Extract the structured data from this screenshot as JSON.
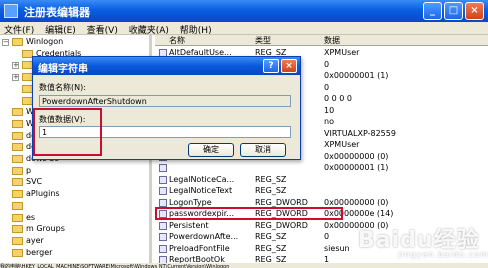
{
  "window": {
    "title": "注册表编辑器",
    "buttons": [
      "_",
      "□",
      "×"
    ]
  },
  "menu": [
    "文件(F)",
    "编辑(E)",
    "查看(V)",
    "收藏夹(A)",
    "帮助(H)"
  ],
  "tree": [
    {
      "label": "Winlogon",
      "indent": 0,
      "expander": "−"
    },
    {
      "label": "Credentials",
      "indent": 1,
      "expander": ""
    },
    {
      "label": "",
      "indent": 1,
      "expander": "+"
    },
    {
      "label": "",
      "indent": 1,
      "expander": "+"
    },
    {
      "label": "",
      "indent": 1,
      "expander": ""
    },
    {
      "label": "",
      "indent": 1,
      "expander": ""
    },
    {
      "label": "WOW",
      "indent": 0,
      "expander": ""
    },
    {
      "label": "WPAE",
      "indent": 0,
      "expander": ""
    },
    {
      "label": "dows Sc",
      "indent": 0,
      "expander": ""
    },
    {
      "label": "dows Sc",
      "indent": 0,
      "expander": ""
    },
    {
      "label": "dows Sc",
      "indent": 0,
      "expander": ""
    },
    {
      "label": "p",
      "indent": 0,
      "expander": ""
    },
    {
      "label": "SVC",
      "indent": 0,
      "expander": ""
    },
    {
      "label": "aPlugins",
      "indent": 0,
      "expander": ""
    },
    {
      "label": "",
      "indent": 0,
      "expander": ""
    },
    {
      "label": "es",
      "indent": 0,
      "expander": ""
    },
    {
      "label": "m Groups",
      "indent": 0,
      "expander": ""
    },
    {
      "label": "ayer",
      "indent": 0,
      "expander": ""
    },
    {
      "label": "berger",
      "indent": 0,
      "expander": ""
    }
  ],
  "list": {
    "headers": {
      "name": "名称",
      "type": "类型",
      "data": "数据"
    },
    "rows": [
      {
        "name": "AltDefaultUse...",
        "type": "REG_SZ",
        "data": "XPMUser"
      },
      {
        "name": "",
        "type": "",
        "data": "0"
      },
      {
        "name": "",
        "type": "",
        "data": "0x00000001 (1)"
      },
      {
        "name": "",
        "type": "",
        "data": "0"
      },
      {
        "name": "",
        "type": "",
        "data": "0 0 0 0"
      },
      {
        "name": "",
        "type": "",
        "data": "10"
      },
      {
        "name": "",
        "type": "",
        "data": "no"
      },
      {
        "name": "",
        "type": "",
        "data": "VIRTUALXP-82559"
      },
      {
        "name": "",
        "type": "",
        "data": "XPMUser"
      },
      {
        "name": "",
        "type": "",
        "data": "0x00000000 (0)"
      },
      {
        "name": "",
        "type": "",
        "data": "0x00000001 (1)"
      },
      {
        "name": "LegalNoticeCa...",
        "type": "REG_SZ",
        "data": ""
      },
      {
        "name": "LegalNoticeText",
        "type": "REG_SZ",
        "data": ""
      },
      {
        "name": "LogonType",
        "type": "REG_DWORD",
        "data": "0x00000000 (0)"
      },
      {
        "name": "passwordexpir...",
        "type": "REG_DWORD",
        "data": "0x0000000e (14)"
      },
      {
        "name": "Persistent",
        "type": "REG_DWORD",
        "data": "0x00000000 (0)"
      },
      {
        "name": "PowerdownAfte...",
        "type": "REG_SZ",
        "data": "0"
      },
      {
        "name": "PreloadFontFile",
        "type": "REG_SZ",
        "data": "siesun"
      },
      {
        "name": "ReportBootOk",
        "type": "REG_SZ",
        "data": "1"
      }
    ]
  },
  "dialog": {
    "title": "编辑字符串",
    "help": "?",
    "close": "×",
    "name_label": "数值名称(N):",
    "name_value": "PowerdownAfterShutdown",
    "data_label": "数值数据(V):",
    "data_value": "1",
    "ok": "确定",
    "cancel": "取消"
  },
  "status": "我的电脑\\HKEY_LOCAL_MACHINE\\SOFTWARE\\Microsoft\\Windows NT\\CurrentVersion\\Winlogon",
  "watermark": {
    "text": "Baidu经验",
    "sub": "jingyan.baidu.com"
  },
  "colors": {
    "highlight": "#c8102e",
    "titlebar": "#0a5fe0"
  }
}
